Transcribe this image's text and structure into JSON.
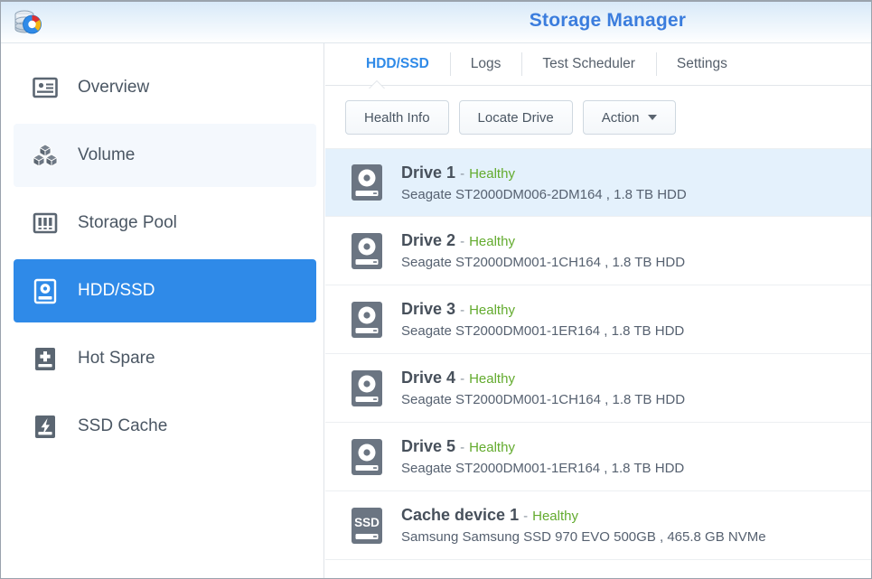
{
  "window": {
    "title": "Storage Manager",
    "logo_icon": "storage-manager-logo-icon"
  },
  "colors": {
    "accent": "#2f8ae8",
    "title": "#3b7ddd",
    "healthy": "#63ab2e",
    "selected_row": "#e4f1fc",
    "sidebar_hover": "#f4f8fd"
  },
  "sidebar": {
    "items": [
      {
        "label": "Overview",
        "icon": "overview-card-icon",
        "state": "normal"
      },
      {
        "label": "Volume",
        "icon": "volume-cubes-icon",
        "state": "hover"
      },
      {
        "label": "Storage Pool",
        "icon": "storage-pool-icon",
        "state": "normal"
      },
      {
        "label": "HDD/SSD",
        "icon": "hdd-ssd-disk-icon",
        "state": "active"
      },
      {
        "label": "Hot Spare",
        "icon": "hot-spare-plus-icon",
        "state": "normal"
      },
      {
        "label": "SSD Cache",
        "icon": "ssd-cache-bolt-icon",
        "state": "normal"
      }
    ]
  },
  "main": {
    "tabs": [
      {
        "label": "HDD/SSD",
        "active": true
      },
      {
        "label": "Logs",
        "active": false
      },
      {
        "label": "Test Scheduler",
        "active": false
      },
      {
        "label": "Settings",
        "active": false
      }
    ],
    "toolbar": {
      "health_info_label": "Health Info",
      "locate_drive_label": "Locate Drive",
      "action_label": "Action"
    },
    "drives": [
      {
        "name": "Drive 1",
        "separator": "-",
        "status": "Healthy",
        "description": "Seagate ST2000DM006-2DM164 , 1.8 TB HDD",
        "icon": "hdd-disk-icon",
        "selected": true
      },
      {
        "name": "Drive 2",
        "separator": "-",
        "status": "Healthy",
        "description": "Seagate ST2000DM001-1CH164 , 1.8 TB HDD",
        "icon": "hdd-disk-icon",
        "selected": false
      },
      {
        "name": "Drive 3",
        "separator": "-",
        "status": "Healthy",
        "description": "Seagate ST2000DM001-1ER164 , 1.8 TB HDD",
        "icon": "hdd-disk-icon",
        "selected": false
      },
      {
        "name": "Drive 4",
        "separator": "-",
        "status": "Healthy",
        "description": "Seagate ST2000DM001-1CH164 , 1.8 TB HDD",
        "icon": "hdd-disk-icon",
        "selected": false
      },
      {
        "name": "Drive 5",
        "separator": "-",
        "status": "Healthy",
        "description": "Seagate ST2000DM001-1ER164 , 1.8 TB HDD",
        "icon": "hdd-disk-icon",
        "selected": false
      },
      {
        "name": "Cache device 1",
        "separator": "-",
        "status": "Healthy",
        "description": "Samsung Samsung SSD 970 EVO 500GB , 465.8 GB NVMe",
        "icon": "ssd-disk-icon",
        "icon_text": "SSD",
        "selected": false
      }
    ]
  }
}
